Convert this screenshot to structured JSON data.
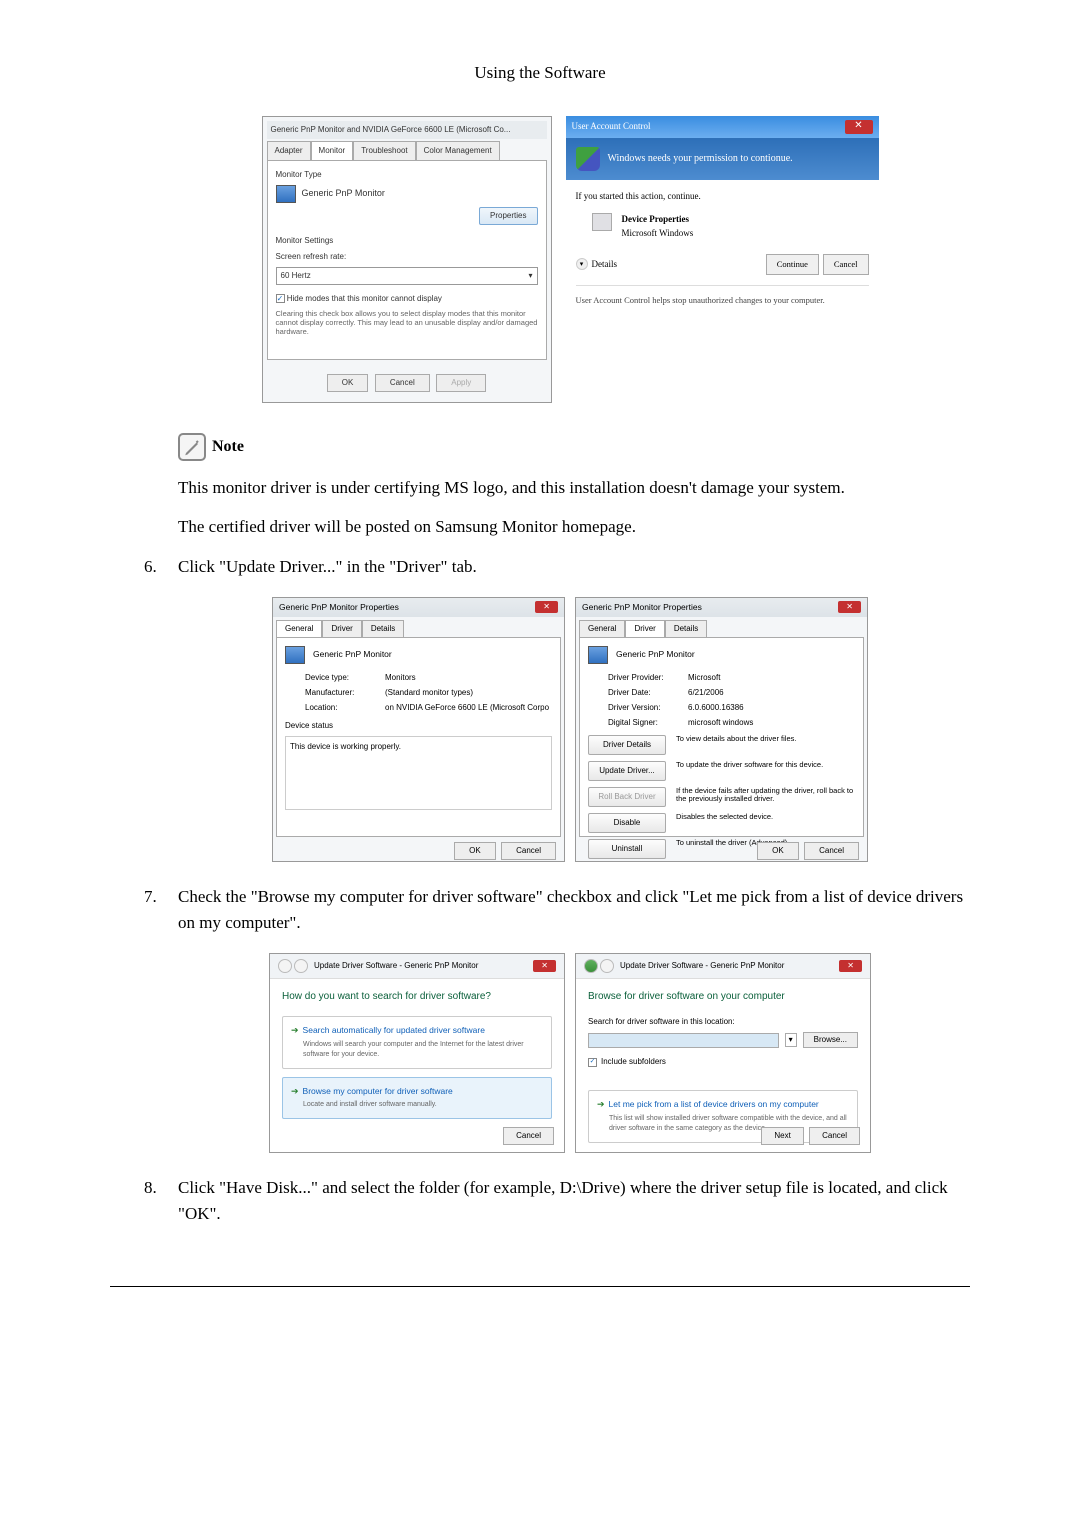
{
  "header": "Using the Software",
  "monitorDialog": {
    "title": "Generic PnP Monitor and NVIDIA GeForce 6600 LE (Microsoft Co... ",
    "tabs": [
      "Adapter",
      "Monitor",
      "Troubleshoot",
      "Color Management"
    ],
    "activeTab": 1,
    "monitorTypeLabel": "Monitor Type",
    "monitorName": "Generic PnP Monitor",
    "propertiesBtn": "Properties",
    "settingsLabel": "Monitor Settings",
    "refreshLabel": "Screen refresh rate:",
    "refreshValue": "60 Hertz",
    "hideCheckbox": "Hide modes that this monitor cannot display",
    "hideHint": "Clearing this check box allows you to select display modes that this monitor cannot display correctly. This may lead to an unusable display and/or damaged hardware.",
    "okBtn": "OK",
    "cancelBtn": "Cancel",
    "applyBtn": "Apply"
  },
  "uac": {
    "titlebar": "User Account Control",
    "banner": "Windows needs your permission to contionue.",
    "line1": "If you started this action, continue.",
    "progName": "Device Properties",
    "progPub": "Microsoft Windows",
    "details": "Details",
    "continue": "Continue",
    "cancel": "Cancel",
    "footer": "User Account Control helps stop unauthorized changes to your computer."
  },
  "noteLabel": "Note",
  "notePara1": "This monitor driver is under certifying MS logo, and this installation doesn't damage your system.",
  "notePara2": "The certified driver will be posted on Samsung Monitor homepage.",
  "step6": {
    "num": "6.",
    "text": "Click \"Update Driver...\" in the \"Driver\" tab."
  },
  "generalProps": {
    "title": "Generic PnP Monitor Properties",
    "tabs": [
      "General",
      "Driver",
      "Details"
    ],
    "monitorName": "Generic PnP Monitor",
    "deviceTypeK": "Device type:",
    "deviceTypeV": "Monitors",
    "manufacturerK": "Manufacturer:",
    "manufacturerV": "(Standard monitor types)",
    "locationK": "Location:",
    "locationV": "on NVIDIA GeForce 6600 LE (Microsoft Corpo",
    "statusLabel": "Device status",
    "statusText": "This device is working properly.",
    "ok": "OK",
    "cancel": "Cancel"
  },
  "driverProps": {
    "providerK": "Driver Provider:",
    "providerV": "Microsoft",
    "dateK": "Driver Date:",
    "dateV": "6/21/2006",
    "versionK": "Driver Version:",
    "versionV": "6.0.6000.16386",
    "signerK": "Digital Signer:",
    "signerV": "microsoft windows",
    "detailsBtn": "Driver Details",
    "detailsDesc": "To view details about the driver files.",
    "updateBtn": "Update Driver...",
    "updateDesc": "To update the driver software for this device.",
    "rollbackBtn": "Roll Back Driver",
    "rollbackDesc": "If the device fails after updating the driver, roll back to the previously installed driver.",
    "disableBtn": "Disable",
    "disableDesc": "Disables the selected device.",
    "uninstallBtn": "Uninstall",
    "uninstallDesc": "To uninstall the driver (Advanced)."
  },
  "step7": {
    "num": "7.",
    "text": "Check the \"Browse my computer for driver software\" checkbox and click \"Let me pick from a list of device drivers on my computer\"."
  },
  "wizardLeft": {
    "breadcrumb": "Update Driver Software - Generic PnP Monitor",
    "heading": "How do you want to search for driver software?",
    "opt1Title": "Search automatically for updated driver software",
    "opt1Sub": "Windows will search your computer and the Internet for the latest driver software for your device.",
    "opt2Title": "Browse my computer for driver software",
    "opt2Sub": "Locate and install driver software manually.",
    "cancel": "Cancel"
  },
  "wizardRight": {
    "breadcrumb": "Update Driver Software - Generic PnP Monitor",
    "heading": "Browse for driver software on your computer",
    "searchLabel": "Search for driver software in this location:",
    "browse": "Browse...",
    "include": "Include subfolders",
    "letTitle": "Let me pick from a list of device drivers on my computer",
    "letSub": "This list will show installed driver software compatible with the device, and all driver software in the same category as the device.",
    "next": "Next",
    "cancel": "Cancel"
  },
  "step8": {
    "num": "8.",
    "text": "Click \"Have Disk...\" and select the folder (for example, D:\\Drive) where the driver setup file is located, and click \"OK\"."
  }
}
